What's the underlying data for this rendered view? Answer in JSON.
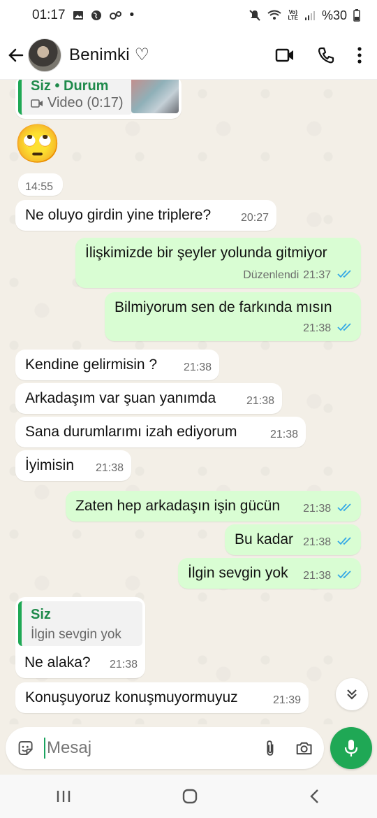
{
  "status_bar": {
    "time": "01:17",
    "dot": "•",
    "battery": "%30"
  },
  "header": {
    "contact_name": "Benimki ♡"
  },
  "quoted_status": {
    "author": "Siz • Durum",
    "media_label": "Video (0:17)"
  },
  "emoji_message": {
    "emoji": "🙄",
    "time": "14:55"
  },
  "messages": [
    {
      "direction": "in",
      "text": "Ne oluyo girdin yine triplere?",
      "time": "20:27"
    },
    {
      "direction": "out",
      "text": "İlişkimizde bir şeyler yolunda gitmiyor",
      "edited": "Düzenlendi",
      "time": "21:37"
    },
    {
      "direction": "out",
      "text": "Bilmiyorum sen de farkında mısın",
      "time": "21:38"
    },
    {
      "direction": "in",
      "text": "Kendine gelirmisin ?",
      "time": "21:38"
    },
    {
      "direction": "in",
      "text": "Arkadaşım var şuan yanımda",
      "time": "21:38"
    },
    {
      "direction": "in",
      "text": "Sana durumlarımı izah ediyorum",
      "time": "21:38"
    },
    {
      "direction": "in",
      "text": "İyimisin",
      "time": "21:38"
    },
    {
      "direction": "out",
      "text": "Zaten hep arkadaşın işin gücün",
      "time": "21:38"
    },
    {
      "direction": "out",
      "text": "Bu kadar",
      "time": "21:38"
    },
    {
      "direction": "out",
      "text": "İlgin sevgin yok",
      "time": "21:38"
    },
    {
      "direction": "in",
      "quote_author": "Siz",
      "quote_text": "İlgin sevgin yok",
      "text": "Ne alaka?",
      "time": "21:38"
    },
    {
      "direction": "in",
      "text": "Konuşuyoruz konuşmuyormuyuz",
      "time": "21:39"
    }
  ],
  "composer": {
    "placeholder": "Mesaj"
  },
  "colors": {
    "accent": "#1fa855",
    "outgoing_bubble": "#d9fdd3",
    "read_tick": "#34a8e6"
  },
  "icons": [
    "back-arrow-icon",
    "video-call-icon",
    "phone-icon",
    "more-vert-icon",
    "sticker-icon",
    "attach-icon",
    "camera-icon",
    "mic-icon",
    "chevron-double-down-icon"
  ]
}
